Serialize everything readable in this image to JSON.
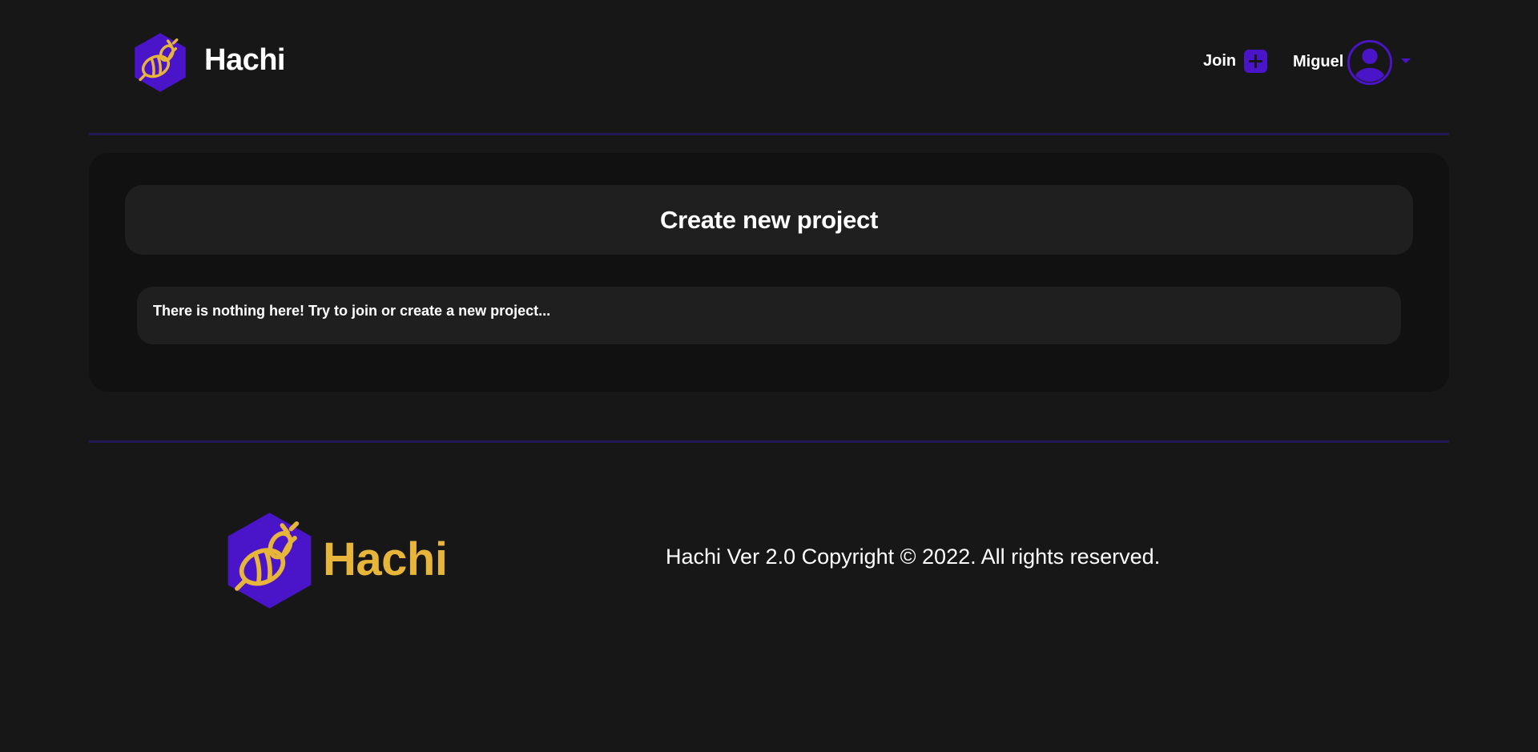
{
  "header": {
    "brand_name": "Hachi",
    "join_label": "Join",
    "user_name": "Miguel"
  },
  "main": {
    "create_project_label": "Create new project",
    "empty_message": "There is nothing here! Try to join or create a new project..."
  },
  "footer": {
    "brand_name": "Hachi",
    "copyright": "Hachi Ver 2.0 Copyright © 2022. All rights reserved."
  },
  "icons": {
    "brand_logo": "bee-hexagon-icon",
    "join": "plus-icon",
    "avatar": "user-avatar-icon",
    "caret": "caret-down-icon"
  },
  "colors": {
    "background": "#171717",
    "panel": "#111111",
    "card": "#1f1f1f",
    "accent_purple": "#4a14c8",
    "accent_gold": "#e7b53a",
    "divider": "#24185a",
    "text": "#ffffff"
  }
}
